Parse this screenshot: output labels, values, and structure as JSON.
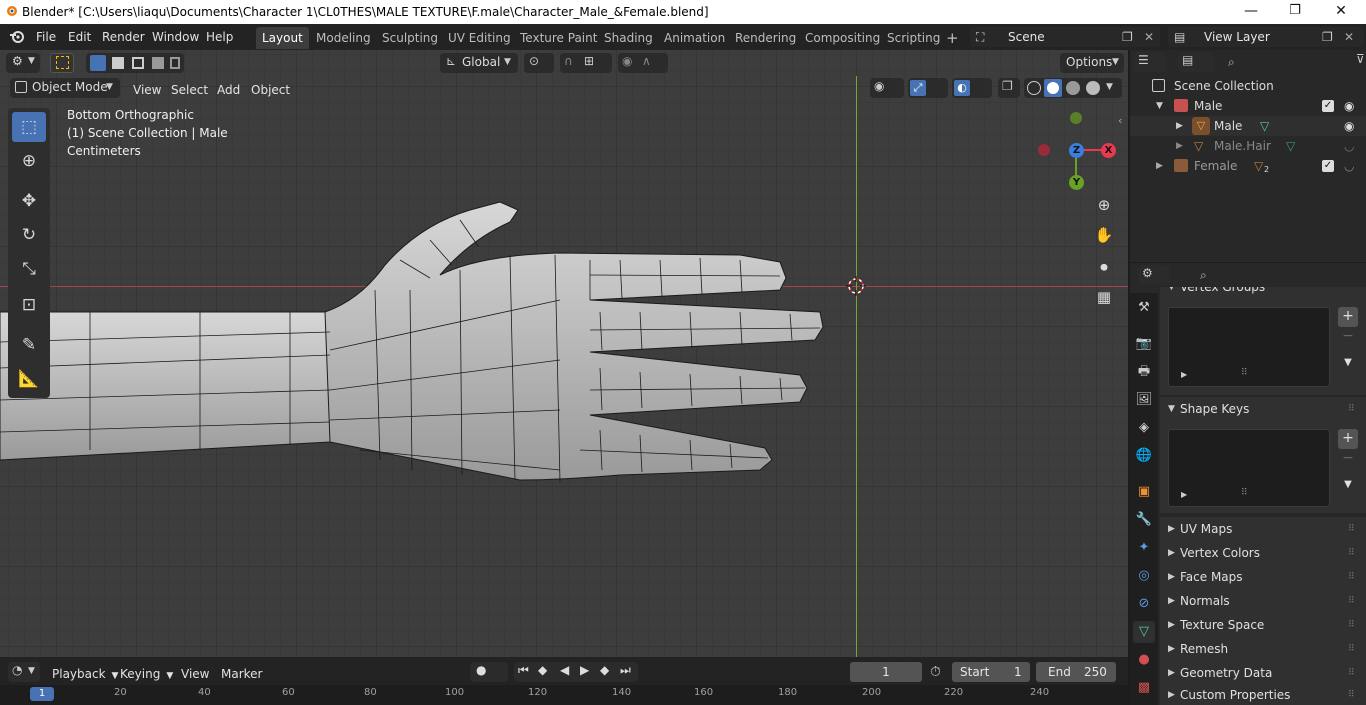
{
  "window": {
    "title": "Blender* [C:\\Users\\liaqu\\Documents\\Character 1\\CL0THES\\MALE TEXTURE\\F.male\\Character_Male_&Female.blend]",
    "minimize": "—",
    "maximize": "❐",
    "close": "✕"
  },
  "menubar": {
    "items": [
      "File",
      "Edit",
      "Render",
      "Window",
      "Help"
    ],
    "workspaces": [
      "Layout",
      "Modeling",
      "Sculpting",
      "UV Editing",
      "Texture Paint",
      "Shading",
      "Animation",
      "Rendering",
      "Compositing",
      "Scripting"
    ],
    "active_workspace": "Layout",
    "add_workspace": "+",
    "scene": "Scene",
    "view_layer": "View Layer"
  },
  "viewport_header": {
    "transform_orientation": "Global",
    "options": "Options",
    "mode": "Object Mode",
    "menus": [
      "View",
      "Select",
      "Add",
      "Object"
    ]
  },
  "viewport_info": {
    "view": "Bottom Orthographic",
    "collection": "(1) Scene Collection | Male",
    "units": "Centimeters"
  },
  "gizmo": {
    "x": "X",
    "y": "Y",
    "z": "Z",
    "colors": {
      "x": "#e8394e",
      "y": "#6aa226",
      "z": "#3a7fe0",
      "neg_x": "#9b2a3a",
      "neg_y": "#5a7f2a"
    }
  },
  "outliner": {
    "root": "Scene Collection",
    "rows": [
      {
        "label": "Male",
        "type": "collection"
      },
      {
        "label": "Male",
        "type": "object"
      },
      {
        "label": "Male.Hair",
        "type": "object"
      },
      {
        "label": "Female",
        "type": "collection"
      }
    ],
    "female_count": "2"
  },
  "properties": {
    "vertex_groups": "Vertex Groups",
    "shape_keys": "Shape Keys",
    "collapsed_panels": [
      "UV Maps",
      "Vertex Colors",
      "Face Maps",
      "Normals",
      "Texture Space",
      "Remesh",
      "Geometry Data",
      "Custom Properties"
    ]
  },
  "timeline": {
    "menus": [
      "Playback",
      "Keying",
      "View",
      "Marker"
    ],
    "current_frame": "1",
    "start_label": "Start",
    "start": "1",
    "end_label": "End",
    "end": "250",
    "ruler_ticks": [
      "1",
      "20",
      "40",
      "60",
      "80",
      "100",
      "120",
      "140",
      "160",
      "180",
      "200",
      "220",
      "240"
    ]
  },
  "colors": {
    "accent": "#4772b3",
    "x_axis": "#a8434e",
    "y_axis": "#7ca33b",
    "viewport_bg": "#3d3d3d"
  }
}
